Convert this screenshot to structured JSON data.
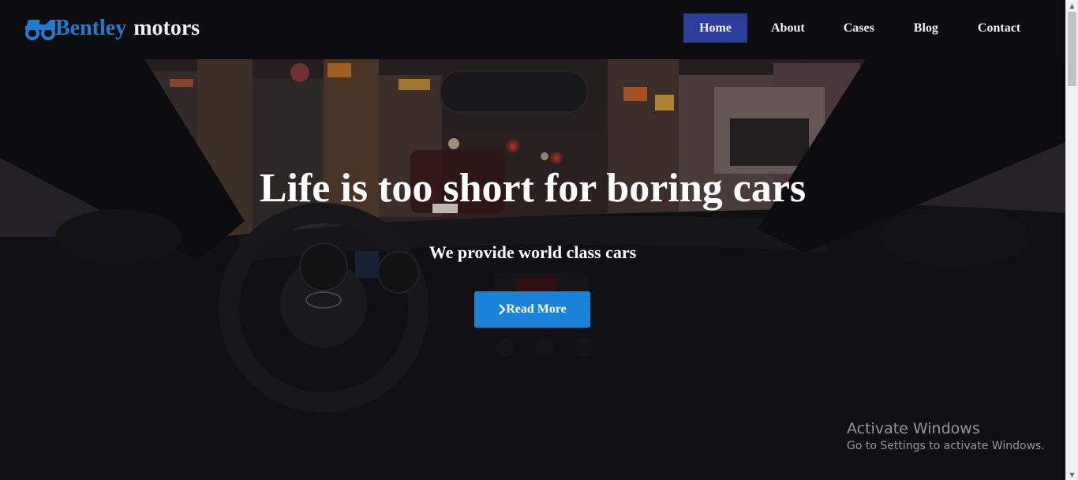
{
  "brand": {
    "name_first": "Bentley",
    "name_second": "motors",
    "icon": "truck-icon",
    "accent_color": "#1e7dd0"
  },
  "nav": {
    "items": [
      {
        "label": "Home",
        "active": true
      },
      {
        "label": "About",
        "active": false
      },
      {
        "label": "Cases",
        "active": false
      },
      {
        "label": "Blog",
        "active": false
      },
      {
        "label": "Contact",
        "active": false
      }
    ],
    "active_color": "#2c3e9c"
  },
  "hero": {
    "title": "Life is too short for boring cars",
    "subtitle": "We provide world class cars",
    "cta_label": "Read More",
    "cta_icon": "chevron-right-icon",
    "cta_color": "#1a83d8",
    "background": "car-interior-night-city-image"
  },
  "watermark": {
    "title": "Activate Windows",
    "subtitle": "Go to Settings to activate Windows."
  },
  "scrollbar": {
    "up_icon": "scroll-up-arrow-icon",
    "down_icon": "scroll-down-arrow-icon"
  }
}
